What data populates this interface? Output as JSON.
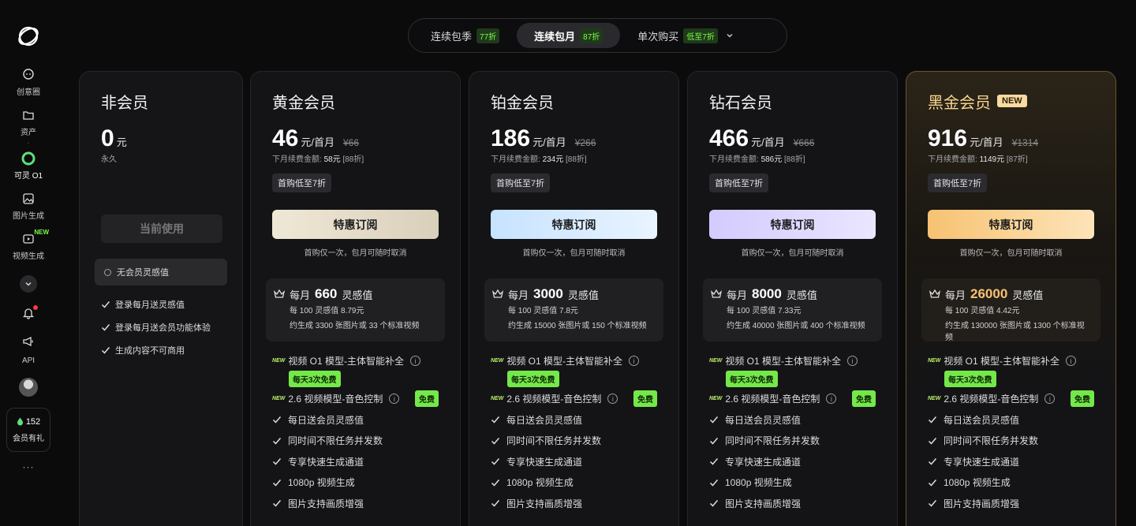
{
  "sidebar": {
    "items": [
      {
        "label": "创意圈",
        "icon": "chat-bubble-icon"
      },
      {
        "label": "资产",
        "icon": "folder-icon"
      },
      {
        "label": "可灵 O1",
        "icon": "kling-o1-icon"
      },
      {
        "label": "图片生成",
        "icon": "image-icon"
      },
      {
        "label": "视频生成",
        "icon": "video-icon",
        "new": "NEW"
      }
    ],
    "api_label": "API",
    "points": "152",
    "gift_label": "会员有礼",
    "more": "···"
  },
  "switcher": {
    "tabs": [
      {
        "label": "连续包季",
        "badge": "77折"
      },
      {
        "label": "连续包月",
        "badge": "87折"
      },
      {
        "label": "单次购买",
        "badge": "低至7折"
      }
    ]
  },
  "plans": {
    "free": {
      "name": "非会员",
      "price": "0",
      "unit": "元",
      "duration": "永久",
      "button": "当前使用",
      "current_note": "无会员灵感值",
      "features": [
        "登录每月送灵感值",
        "登录每月送会员功能体验",
        "生成内容不可商用"
      ]
    },
    "gold": {
      "name": "黄金会员",
      "price": "46",
      "unit": "元/首月",
      "orig": "¥66",
      "renew_label": "下月续费金额:",
      "renew_value": "58元",
      "renew_disc": "[88折]",
      "tag": "首购低至7折",
      "button": "特惠订阅",
      "note": "首购仅一次，包月可随时取消",
      "quota_pre": "每月",
      "quota": "660",
      "quota_unit": "灵感值",
      "quota_l1": "每 100 灵感值 8.79元",
      "quota_l2": "约生成 3300 张图片或 33 个标准视频"
    },
    "plat": {
      "name": "铂金会员",
      "price": "186",
      "unit": "元/首月",
      "orig": "¥266",
      "renew_label": "下月续费金额:",
      "renew_value": "234元",
      "renew_disc": "[88折]",
      "tag": "首购低至7折",
      "button": "特惠订阅",
      "note": "首购仅一次，包月可随时取消",
      "quota_pre": "每月",
      "quota": "3000",
      "quota_unit": "灵感值",
      "quota_l1": "每 100 灵感值 7.8元",
      "quota_l2": "约生成 15000 张图片或 150 个标准视频"
    },
    "dia": {
      "name": "钻石会员",
      "price": "466",
      "unit": "元/首月",
      "orig": "¥666",
      "renew_label": "下月续费金额:",
      "renew_value": "586元",
      "renew_disc": "[88折]",
      "tag": "首购低至7折",
      "button": "特惠订阅",
      "note": "首购仅一次，包月可随时取消",
      "quota_pre": "每月",
      "quota": "8000",
      "quota_unit": "灵感值",
      "quota_l1": "每 100 灵感值 7.33元",
      "quota_l2": "约生成 40000 张图片或 400 个标准视频"
    },
    "black": {
      "name": "黑金会员",
      "new": "NEW",
      "price": "916",
      "unit": "元/首月",
      "orig": "¥1314",
      "renew_label": "下月续费金额:",
      "renew_value": "1149元",
      "renew_disc": "[87折]",
      "tag": "首购低至7折",
      "button": "特惠订阅",
      "note": "首购仅一次，包月可随时取消",
      "quota_pre": "每月",
      "quota": "26000",
      "quota_unit": "灵感值",
      "quota_l1": "每 100 灵感值 4.42元",
      "quota_l2": "约生成 130000 张图片或 1300 个标准视频"
    }
  },
  "common": {
    "new_tag": "NEW",
    "f1": "视频 O1 模型-主体智能补全",
    "f1_pill": "每天3次免费",
    "f2": "2.6 视频模型-音色控制",
    "f2_pill": "免费",
    "info": "i",
    "features": [
      "每日送会员灵感值",
      "同时间不限任务并发数",
      "专享快速生成通道",
      "1080p 视频生成",
      "图片支持画质增强"
    ]
  }
}
